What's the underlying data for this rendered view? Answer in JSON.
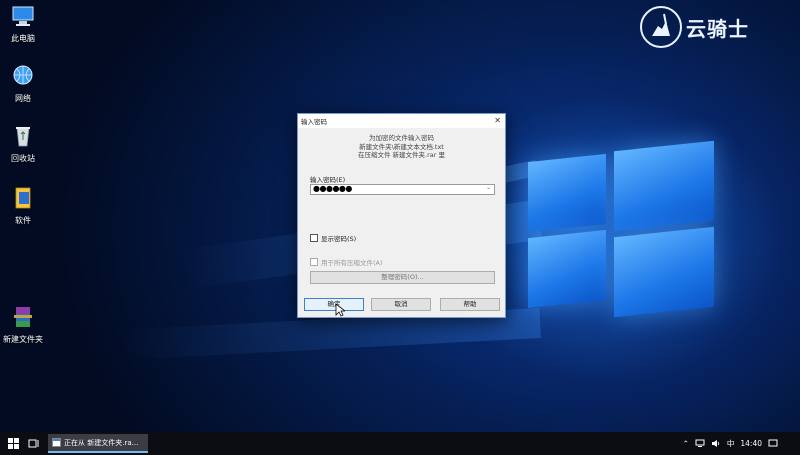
{
  "desktop_icons": [
    {
      "label": "此电脑",
      "icon": "computer-icon"
    },
    {
      "label": "网络",
      "icon": "network-icon"
    },
    {
      "label": "回收站",
      "icon": "recycle-bin-icon"
    },
    {
      "label": "软件",
      "icon": "folder-icon"
    },
    {
      "label": "新建文件夹",
      "icon": "winrar-archive-icon"
    }
  ],
  "brand": {
    "text": "云骑士"
  },
  "dialog": {
    "title": "输入密码",
    "close": "✕",
    "info_lines": [
      "为加密的文件输入密码",
      "新建文件夹\\新建文本文档.txt",
      "在压缩文件 新建文件夹.rar 里"
    ],
    "password_label": "输入密码(E)",
    "password_value": "●●●●●●",
    "show_password": "显示密码(S)",
    "use_for_all": "用于所有压缩文件(A)",
    "organize_button": "整理密码(O)...",
    "ok_button": "确定",
    "cancel_button": "取消",
    "help_button": "帮助"
  },
  "taskbar": {
    "task_label": "正在从 新建文件夹.ra...",
    "ime": "中",
    "time": "14:40"
  }
}
